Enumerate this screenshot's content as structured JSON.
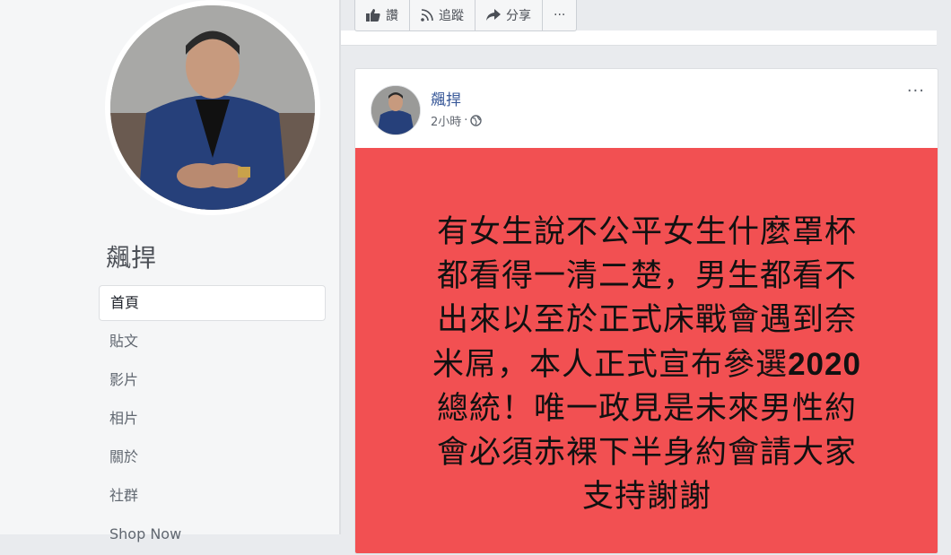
{
  "page": {
    "name": "飆捍",
    "nav": [
      {
        "label": "首頁",
        "active": true
      },
      {
        "label": "貼文",
        "active": false
      },
      {
        "label": "影片",
        "active": false
      },
      {
        "label": "相片",
        "active": false
      },
      {
        "label": "關於",
        "active": false
      },
      {
        "label": "社群",
        "active": false
      },
      {
        "label": "Shop Now",
        "active": false
      }
    ]
  },
  "actions": [
    {
      "icon": "like-icon",
      "label": "讚"
    },
    {
      "icon": "rss-follow-icon",
      "label": "追蹤"
    },
    {
      "icon": "share-arrow-icon",
      "label": "分享"
    },
    {
      "icon": "more-icon",
      "label": "···"
    }
  ],
  "post": {
    "author": "飆捍",
    "time": "2小時",
    "separator": "·",
    "privacy_icon": "globe-icon",
    "menu": "···",
    "lines": [
      "有女生說不公平女生什麼罩杯",
      "都看得一清二楚，男生都看不",
      "出來以至於正式床戰會遇到奈",
      "米屌，本人正式宣布參選",
      "總統！唯一政見是未來男性約",
      "會必須赤裸下半身約會請大家",
      "支持謝謝"
    ],
    "year": "2020",
    "background_color": "#f25052"
  }
}
